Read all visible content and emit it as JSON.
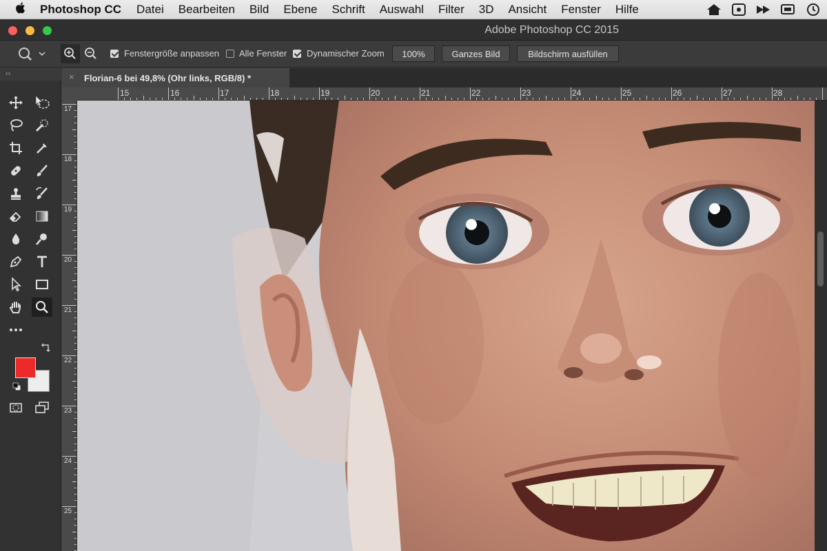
{
  "menubar": {
    "app": "Photoshop CC",
    "items": [
      "Datei",
      "Bearbeiten",
      "Bild",
      "Ebene",
      "Schrift",
      "Auswahl",
      "Filter",
      "3D",
      "Ansicht",
      "Fenster",
      "Hilfe"
    ]
  },
  "window": {
    "title": "Adobe Photoshop CC 2015"
  },
  "options": {
    "fit_window": "Fenstergröße anpassen",
    "all_windows": "Alle Fenster",
    "dynamic_zoom": "Dynamischer Zoom",
    "zoom_100": "100%",
    "fit_screen": "Ganzes Bild",
    "fill_screen": "Bildschirm ausfüllen"
  },
  "document": {
    "tab_title": "Florian-6 bei 49,8% (Ohr links, RGB/8) *",
    "close_symbol": "×"
  },
  "panel": {
    "collapse_glyph": "‹‹"
  },
  "rulers": {
    "horizontal": [
      "15",
      "16",
      "17",
      "18",
      "19",
      "20",
      "21",
      "22",
      "23",
      "24",
      "25",
      "26",
      "27",
      "28"
    ],
    "vertical": [
      "17",
      "18",
      "19",
      "20",
      "21",
      "22",
      "23",
      "24",
      "25"
    ]
  },
  "colors": {
    "foreground": "#ec2a2a",
    "background": "#ededed"
  }
}
